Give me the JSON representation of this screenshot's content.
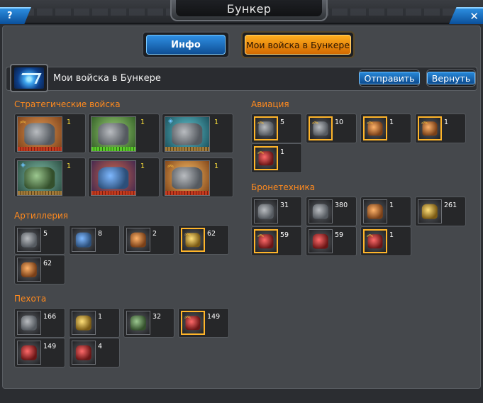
{
  "window": {
    "title": "Бункер",
    "help_label": "?",
    "close_label": "✕"
  },
  "tabs": {
    "info": "Инфо",
    "my_troops": "Мои войска в Бункере"
  },
  "header": {
    "title": "Мои войска в Бункере",
    "send": "Отправить",
    "back": "Вернуть"
  },
  "sections": {
    "strategic": {
      "title": "Стратегические войска",
      "items": [
        {
          "qty": "1",
          "icon": "walker-mech"
        },
        {
          "qty": "1",
          "icon": "battleship"
        },
        {
          "qty": "1",
          "icon": "heavy-mech"
        },
        {
          "qty": "1",
          "icon": "tank-fortress"
        },
        {
          "qty": "1",
          "icon": "gunship"
        },
        {
          "qty": "1",
          "icon": "battle-robot"
        }
      ]
    },
    "artillery": {
      "title": "Артиллерия",
      "items": [
        {
          "qty": "5",
          "icon": "artillery-grey"
        },
        {
          "qty": "8",
          "icon": "artillery-blue"
        },
        {
          "qty": "2",
          "icon": "artillery-orange"
        },
        {
          "qty": "62",
          "icon": "artillery-gold"
        },
        {
          "qty": "62",
          "icon": "artillery-bronze"
        }
      ]
    },
    "infantry": {
      "title": "Пехота",
      "items": [
        {
          "qty": "166",
          "icon": "soldier-grey"
        },
        {
          "qty": "1",
          "icon": "soldier-gold"
        },
        {
          "qty": "32",
          "icon": "soldier-green"
        },
        {
          "qty": "149",
          "icon": "mech-red"
        },
        {
          "qty": "149",
          "icon": "soldier-red"
        },
        {
          "qty": "4",
          "icon": "heavy-red"
        }
      ]
    },
    "aviation": {
      "title": "Авиация",
      "items": [
        {
          "qty": "5",
          "icon": "aircraft-grey"
        },
        {
          "qty": "10",
          "icon": "aircraft-dark"
        },
        {
          "qty": "1",
          "icon": "aircraft-orange"
        },
        {
          "qty": "1",
          "icon": "aircraft-bronze"
        },
        {
          "qty": "1",
          "icon": "aircraft-red"
        }
      ]
    },
    "armor": {
      "title": "Бронетехника",
      "items": [
        {
          "qty": "31",
          "icon": "vehicle-grey"
        },
        {
          "qty": "380",
          "icon": "vehicle-dark"
        },
        {
          "qty": "1",
          "icon": "vehicle-orange"
        },
        {
          "qty": "261",
          "icon": "vehicle-gold"
        },
        {
          "qty": "59",
          "icon": "walker-red"
        },
        {
          "qty": "59",
          "icon": "walker-dark"
        },
        {
          "qty": "1",
          "icon": "walker-red-gold"
        }
      ]
    }
  }
}
